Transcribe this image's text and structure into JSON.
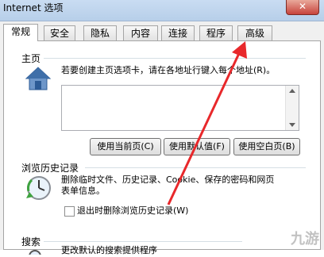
{
  "window": {
    "title": "Internet 选项",
    "close": "✕"
  },
  "tabs": [
    "常规",
    "安全",
    "隐私",
    "内容",
    "连接",
    "程序",
    "高级"
  ],
  "home": {
    "label": "主页",
    "description": "若要创建主页选项卡，请在各地址行键入每个地址(R)。",
    "buttons": [
      "使用当前页(C)",
      "使用默认值(F)",
      "使用空白页(B)"
    ]
  },
  "history": {
    "label": "浏览历史记录",
    "description_line1": "删除临时文件、历史记录、Cookie、保存的密码和网页",
    "description_line2": "表单信息。",
    "checkbox_label": "退出时删除浏览历史记录(W)"
  },
  "search": {
    "label": "搜索",
    "description": "更改默认的搜索提供程序"
  },
  "watermark": "九游",
  "colors": {
    "arrow": "#e8282b",
    "accent": "#1e5aa8"
  },
  "icons": [
    "house-icon",
    "clock-icon",
    "search-icon",
    "close-icon"
  ]
}
